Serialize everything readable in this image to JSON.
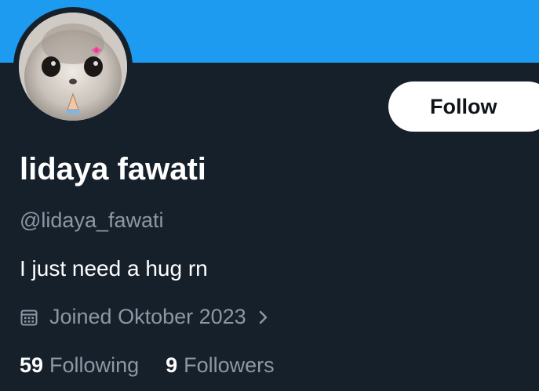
{
  "profile": {
    "display_name": "lidaya fawati",
    "handle": "@lidaya_fawati",
    "bio": "I just need a hug rn",
    "joined": "Joined Oktober 2023",
    "follow_label": "Follow",
    "avatar": "hamster-praying-photo"
  },
  "stats": {
    "following_count": "59",
    "following_label": "Following",
    "followers_count": "9",
    "followers_label": "Followers"
  },
  "icons": {
    "calendar": "calendar-icon",
    "chevron": "chevron-right-icon"
  },
  "colors": {
    "banner": "#1d9bf0",
    "background": "#15202b",
    "secondary_text": "#8b98a5",
    "follow_button_bg": "#ffffff"
  }
}
